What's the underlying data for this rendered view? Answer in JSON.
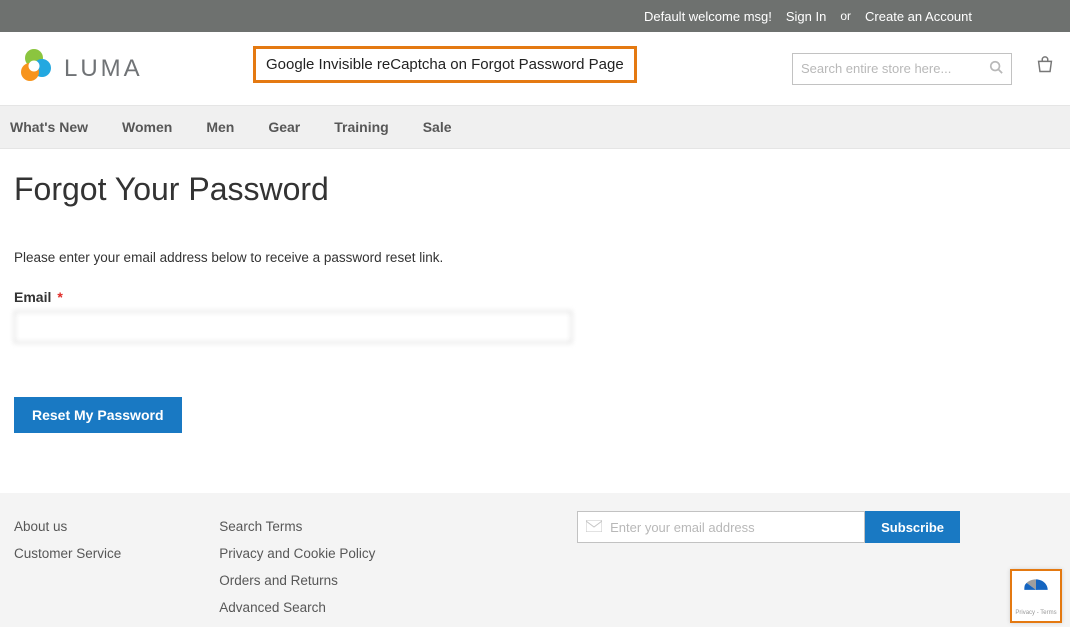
{
  "topbar": {
    "welcome": "Default welcome msg!",
    "signin": "Sign In",
    "or": "or",
    "create": "Create an Account"
  },
  "header": {
    "brand": "LUMA",
    "annotation": "Google Invisible reCaptcha on Forgot Password Page",
    "search_placeholder": "Search entire store here..."
  },
  "nav": [
    "What's New",
    "Women",
    "Men",
    "Gear",
    "Training",
    "Sale"
  ],
  "main": {
    "title": "Forgot Your Password",
    "instruction": "Please enter your email address below to receive a password reset link.",
    "email_label": "Email",
    "email_value": "",
    "reset_btn": "Reset My Password"
  },
  "footer": {
    "col1": [
      "About us",
      "Customer Service"
    ],
    "col2": [
      "Search Terms",
      "Privacy and Cookie Policy",
      "Orders and Returns",
      "Advanced Search"
    ],
    "nl_placeholder": "Enter your email address",
    "subscribe": "Subscribe",
    "recaptcha_terms": "Privacy - Terms"
  }
}
